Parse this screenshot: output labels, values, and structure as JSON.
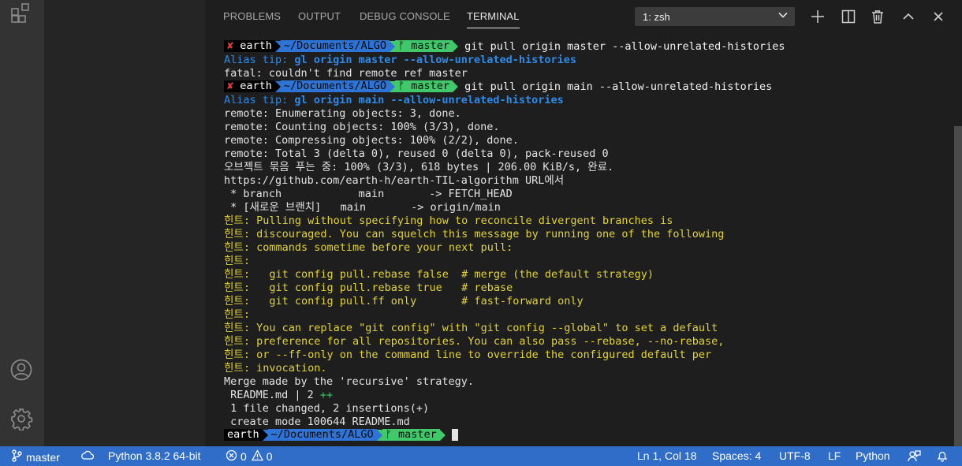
{
  "panel": {
    "tabs": [
      "PROBLEMS",
      "OUTPUT",
      "DEBUG CONSOLE",
      "TERMINAL"
    ],
    "active_tab": "TERMINAL",
    "terminal_select": "1: zsh"
  },
  "prompt": {
    "status_x": "✘",
    "user": "earth",
    "path": "~/Documents/ALGO",
    "branch": "master",
    "branch_glyph": "ᚠ"
  },
  "terminal": {
    "cmd1": "git pull origin master --allow-unrelated-histories",
    "alias1_prefix": "Alias tip: ",
    "alias1_cmd": "gl origin master --allow-unrelated-histories",
    "fatal": "fatal: couldn't find remote ref master",
    "cmd2": "git pull origin main --allow-unrelated-histories",
    "alias2_prefix": "Alias tip: ",
    "alias2_cmd": "gl origin main --allow-unrelated-histories",
    "output_lines": [
      "remote: Enumerating objects: 3, done.",
      "remote: Counting objects: 100% (3/3), done.",
      "remote: Compressing objects: 100% (2/2), done.",
      "remote: Total 3 (delta 0), reused 0 (delta 0), pack-reused 0",
      "오브젝트 묶음 푸는 중: 100% (3/3), 618 bytes | 206.00 KiB/s, 완료.",
      "https://github.com/earth-h/earth-TIL-algorithm URL에서",
      " * branch            main       -> FETCH_HEAD",
      " * [새로운 브랜치]   main       -> origin/main"
    ],
    "hint_lines": [
      "힌트: Pulling without specifying how to reconcile divergent branches is",
      "힌트: discouraged. You can squelch this message by running one of the following",
      "힌트: commands sometime before your next pull:",
      "힌트:",
      "힌트:   git config pull.rebase false  # merge (the default strategy)",
      "힌트:   git config pull.rebase true   # rebase",
      "힌트:   git config pull.ff only       # fast-forward only",
      "힌트:",
      "힌트: You can replace \"git config\" with \"git config --global\" to set a default",
      "힌트: preference for all repositories. You can also pass --rebase, --no-rebase,",
      "힌트: or --ff-only on the command line to override the configured default per",
      "힌트: invocation."
    ],
    "merge_line": "Merge made by the 'recursive' strategy.",
    "diffstat_file": " README.md | 2 ",
    "diffstat_plus": "++",
    "summary_line": " 1 file changed, 2 insertions(+)",
    "create_line": " create mode 100644 README.md"
  },
  "statusbar": {
    "branch": "master",
    "python": "Python 3.8.2 64-bit",
    "errors": "0",
    "warnings": "0",
    "position": "Ln 1, Col 18",
    "spaces": "Spaces: 4",
    "encoding": "UTF-8",
    "eol": "LF",
    "language": "Python"
  },
  "colors": {
    "statusbar": "#2f6dc8",
    "prompt_blue": "#2e74d6",
    "prompt_green": "#41c86b",
    "hint_yellow": "#e2d336",
    "alias_blue": "#2d8bea"
  }
}
